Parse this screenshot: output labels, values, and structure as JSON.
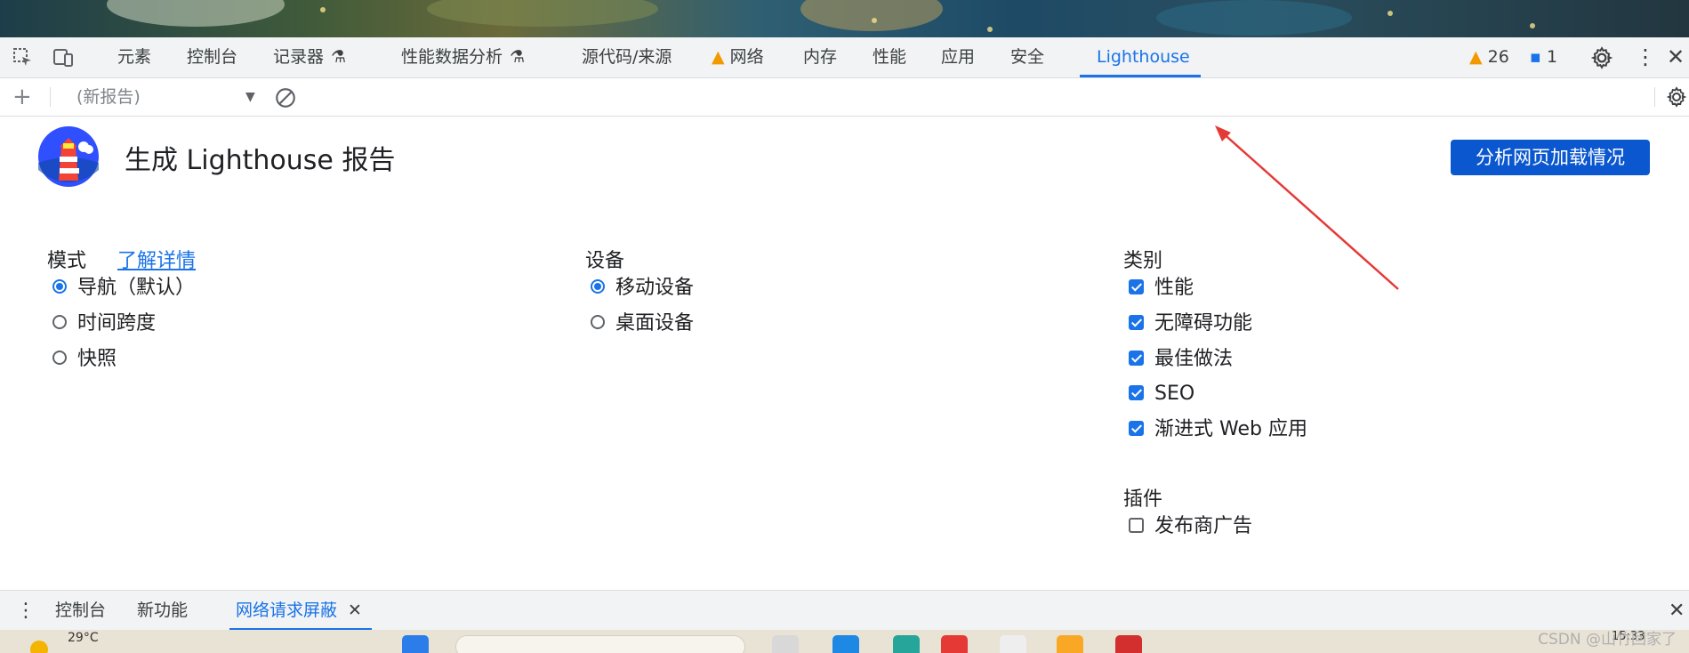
{
  "colors": {
    "accent": "#1a73e8",
    "primary_button": "#0b57d0",
    "warning": "#f29900",
    "annotation_arrow": "#e53935"
  },
  "devtools": {
    "tabs": [
      {
        "label": "元素"
      },
      {
        "label": "控制台"
      },
      {
        "label": "记录器",
        "icon": "flask-icon"
      },
      {
        "label": "性能数据分析",
        "icon": "flask-icon"
      },
      {
        "label": "源代码/来源"
      },
      {
        "label": "网络",
        "icon": "warning-icon"
      },
      {
        "label": "内存"
      },
      {
        "label": "性能"
      },
      {
        "label": "应用"
      },
      {
        "label": "安全"
      },
      {
        "label": "Lighthouse",
        "active": true
      }
    ],
    "warnings_count": "26",
    "messages_count": "1"
  },
  "toolbar": {
    "report_select": "(新报告)"
  },
  "lighthouse": {
    "title": "生成 Lighthouse 报告",
    "analyze_button": "分析网页加载情况",
    "mode": {
      "heading": "模式",
      "learn_more": "了解详情",
      "options": [
        {
          "label": "导航（默认）",
          "selected": true
        },
        {
          "label": "时间跨度",
          "selected": false
        },
        {
          "label": "快照",
          "selected": false
        }
      ]
    },
    "device": {
      "heading": "设备",
      "options": [
        {
          "label": "移动设备",
          "selected": true
        },
        {
          "label": "桌面设备",
          "selected": false
        }
      ]
    },
    "categories": {
      "heading": "类别",
      "items": [
        {
          "label": "性能",
          "checked": true
        },
        {
          "label": "无障碍功能",
          "checked": true
        },
        {
          "label": "最佳做法",
          "checked": true
        },
        {
          "label": "SEO",
          "checked": true
        },
        {
          "label": "渐进式 Web 应用",
          "checked": true
        }
      ]
    },
    "plugins": {
      "heading": "插件",
      "items": [
        {
          "label": "发布商广告",
          "checked": false
        }
      ]
    }
  },
  "drawer": {
    "tabs": [
      {
        "label": "控制台"
      },
      {
        "label": "新功能"
      },
      {
        "label": "网络请求屏蔽",
        "active": true
      }
    ]
  },
  "taskbar": {
    "weather": "29°C",
    "time": "15:33"
  },
  "watermark": "CSDN @山竹回家了"
}
